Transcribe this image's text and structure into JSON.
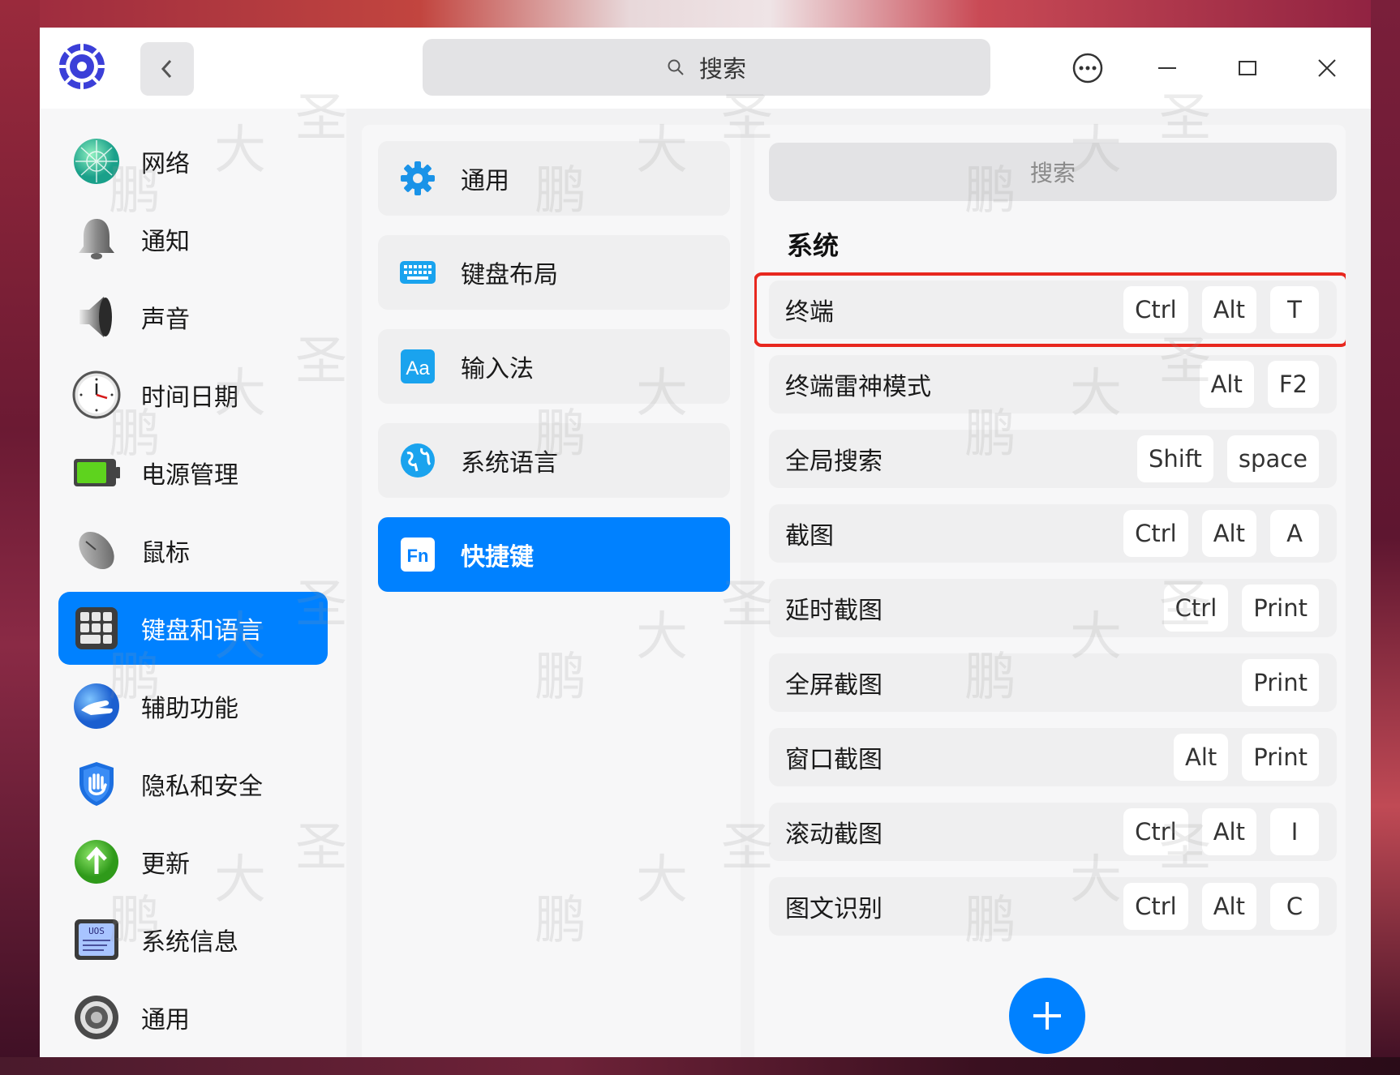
{
  "titlebar": {
    "search_placeholder": "搜索"
  },
  "sidebar": {
    "items": [
      {
        "label": "网络",
        "icon": "network-icon"
      },
      {
        "label": "通知",
        "icon": "bell-icon"
      },
      {
        "label": "声音",
        "icon": "speaker-icon"
      },
      {
        "label": "时间日期",
        "icon": "clock-icon"
      },
      {
        "label": "电源管理",
        "icon": "battery-icon"
      },
      {
        "label": "鼠标",
        "icon": "mouse-icon"
      },
      {
        "label": "键盘和语言",
        "icon": "keyboard-icon",
        "active": true
      },
      {
        "label": "辅助功能",
        "icon": "accessibility-icon"
      },
      {
        "label": "隐私和安全",
        "icon": "privacy-shield-icon"
      },
      {
        "label": "更新",
        "icon": "update-arrow-icon"
      },
      {
        "label": "系统信息",
        "icon": "system-info-icon"
      },
      {
        "label": "通用",
        "icon": "general-gear-icon"
      }
    ]
  },
  "middle": {
    "items": [
      {
        "label": "通用",
        "icon": "gear-icon"
      },
      {
        "label": "键盘布局",
        "icon": "keyboard-layout-icon"
      },
      {
        "label": "输入法",
        "icon": "input-method-icon",
        "icon_text": "Aa"
      },
      {
        "label": "系统语言",
        "icon": "globe-icon"
      },
      {
        "label": "快捷键",
        "icon": "fn-key-icon",
        "icon_text": "Fn",
        "active": true
      }
    ]
  },
  "right": {
    "search_placeholder": "搜索",
    "section_title": "系统",
    "shortcuts": [
      {
        "name": "终端",
        "keys": [
          "Ctrl",
          "Alt",
          "T"
        ],
        "highlighted": true
      },
      {
        "name": "终端雷神模式",
        "keys": [
          "Alt",
          "F2"
        ]
      },
      {
        "name": "全局搜索",
        "keys": [
          "Shift",
          "space"
        ]
      },
      {
        "name": "截图",
        "keys": [
          "Ctrl",
          "Alt",
          "A"
        ]
      },
      {
        "name": "延时截图",
        "keys": [
          "Ctrl",
          "Print"
        ]
      },
      {
        "name": "全屏截图",
        "keys": [
          "Print"
        ]
      },
      {
        "name": "窗口截图",
        "keys": [
          "Alt",
          "Print"
        ]
      },
      {
        "name": "滚动截图",
        "keys": [
          "Ctrl",
          "Alt",
          "I"
        ]
      },
      {
        "name": "图文识别",
        "keys": [
          "Ctrl",
          "Alt",
          "C"
        ]
      }
    ]
  },
  "watermark": [
    "圣",
    "大",
    "鹏"
  ],
  "colors": {
    "accent": "#0081ff",
    "highlight_border": "#e8281f"
  }
}
